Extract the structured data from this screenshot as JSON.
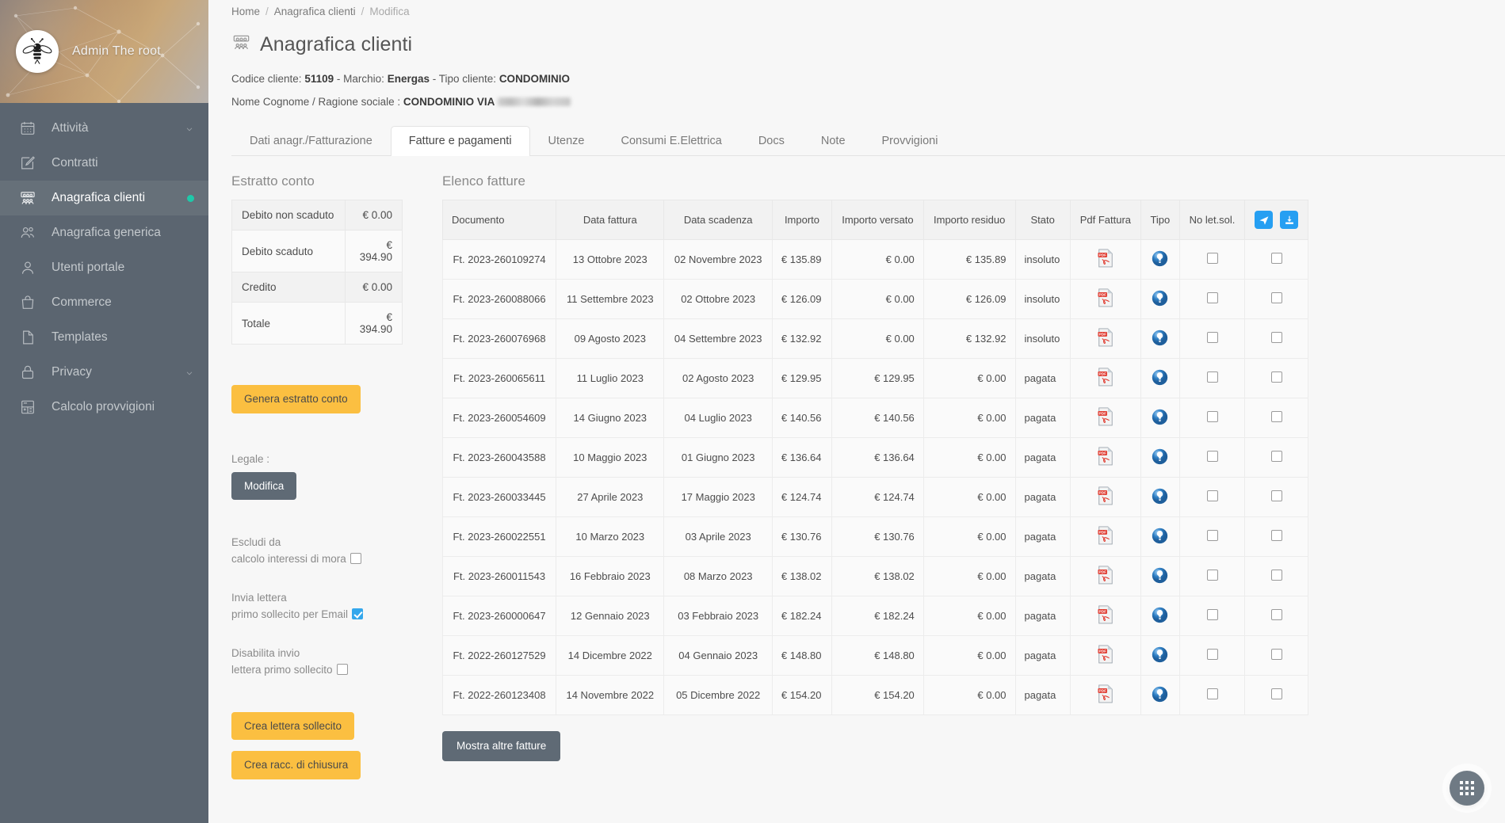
{
  "sidebar": {
    "profile": {
      "username": "Admin The root",
      "avatar_icon": "bee-logo"
    },
    "items": [
      {
        "label": "Attività",
        "icon": "calendar-icon",
        "expandable": true,
        "active": false,
        "dot": false
      },
      {
        "label": "Contratti",
        "icon": "edit-square-icon",
        "expandable": false,
        "active": false,
        "dot": false
      },
      {
        "label": "Anagrafica clienti",
        "icon": "clients-icon",
        "expandable": false,
        "active": true,
        "dot": true
      },
      {
        "label": "Anagrafica generica",
        "icon": "people-icon",
        "expandable": false,
        "active": false,
        "dot": false
      },
      {
        "label": "Utenti portale",
        "icon": "user-icon",
        "expandable": false,
        "active": false,
        "dot": false
      },
      {
        "label": "Commerce",
        "icon": "bag-icon",
        "expandable": false,
        "active": false,
        "dot": false
      },
      {
        "label": "Templates",
        "icon": "file-icon",
        "expandable": false,
        "active": false,
        "dot": false
      },
      {
        "label": "Privacy",
        "icon": "lock-icon",
        "expandable": true,
        "active": false,
        "dot": false
      },
      {
        "label": "Calcolo provvigioni",
        "icon": "calculator-icon",
        "expandable": false,
        "active": false,
        "dot": false
      }
    ]
  },
  "breadcrumb": {
    "home": "Home",
    "section": "Anagrafica clienti",
    "current": "Modifica",
    "separator": "/"
  },
  "page": {
    "title": "Anagrafica clienti",
    "icon": "clients-icon"
  },
  "customer": {
    "codice_label": "Codice cliente:",
    "codice_value": "51109",
    "dash1": "-",
    "marchio_label": "Marchio:",
    "marchio_value": "Energas",
    "dash2": "-",
    "tipo_label": "Tipo cliente:",
    "tipo_value": "CONDOMINIO",
    "nome_label": "Nome Cognome / Ragione sociale :",
    "nome_value": "CONDOMINIO VIA"
  },
  "tabs": [
    {
      "label": "Dati anagr./Fatturazione",
      "active": false
    },
    {
      "label": "Fatture e pagamenti",
      "active": true
    },
    {
      "label": "Utenze",
      "active": false
    },
    {
      "label": "Consumi E.Elettrica",
      "active": false
    },
    {
      "label": "Docs",
      "active": false
    },
    {
      "label": "Note",
      "active": false
    },
    {
      "label": "Provvigioni",
      "active": false
    }
  ],
  "estratto_conto": {
    "title": "Estratto conto",
    "rows": [
      {
        "label": "Debito non scaduto",
        "value": "€ 0.00"
      },
      {
        "label": "Debito scaduto",
        "value": "€ 394.90"
      },
      {
        "label": "Credito",
        "value": "€ 0.00"
      },
      {
        "label": "Totale",
        "value": "€ 394.90"
      }
    ],
    "genera_button": "Genera estratto conto",
    "legale_label": "Legale :",
    "modifica_button": "Modifica",
    "checkboxes": [
      {
        "line1": "Escludi da",
        "line2": "calcolo interessi di mora",
        "checked": false
      },
      {
        "line1": "Invia lettera",
        "line2": "primo sollecito per Email",
        "checked": true
      },
      {
        "line1": "Disabilita invio",
        "line2": "lettera primo sollecito",
        "checked": false
      }
    ],
    "crea_lettera_button": "Crea lettera sollecito",
    "crea_racc_button": "Crea racc. di chiusura"
  },
  "invoices": {
    "title": "Elenco fatture",
    "columns": [
      "Documento",
      "Data fattura",
      "Data scadenza",
      "Importo",
      "Importo versato",
      "Importo residuo",
      "Stato",
      "Pdf Fattura",
      "Tipo",
      "No let.sol."
    ],
    "header_actions": [
      {
        "name": "send-icon",
        "title": "Invia"
      },
      {
        "name": "download-icon",
        "title": "Scarica"
      }
    ],
    "rows": [
      {
        "documento": "Ft. 2023-260109274",
        "data_fattura": "13 Ottobre 2023",
        "data_scadenza": "02 Novembre 2023",
        "importo": "€ 135.89",
        "importo_versato": "€ 0.00",
        "importo_residuo": "€ 135.89",
        "stato": "insoluto",
        "pdf": "pdf-icon",
        "tipo": "bulb-icon",
        "no_let_sol": false,
        "azione": false
      },
      {
        "documento": "Ft. 2023-260088066",
        "data_fattura": "11 Settembre 2023",
        "data_scadenza": "02 Ottobre 2023",
        "importo": "€ 126.09",
        "importo_versato": "€ 0.00",
        "importo_residuo": "€ 126.09",
        "stato": "insoluto",
        "pdf": "pdf-icon",
        "tipo": "bulb-icon",
        "no_let_sol": false,
        "azione": false
      },
      {
        "documento": "Ft. 2023-260076968",
        "data_fattura": "09 Agosto 2023",
        "data_scadenza": "04 Settembre 2023",
        "importo": "€ 132.92",
        "importo_versato": "€ 0.00",
        "importo_residuo": "€ 132.92",
        "stato": "insoluto",
        "pdf": "pdf-icon",
        "tipo": "bulb-icon",
        "no_let_sol": false,
        "azione": false
      },
      {
        "documento": "Ft. 2023-260065611",
        "data_fattura": "11 Luglio 2023",
        "data_scadenza": "02 Agosto 2023",
        "importo": "€ 129.95",
        "importo_versato": "€ 129.95",
        "importo_residuo": "€ 0.00",
        "stato": "pagata",
        "pdf": "pdf-icon",
        "tipo": "bulb-icon",
        "no_let_sol": false,
        "azione": false
      },
      {
        "documento": "Ft. 2023-260054609",
        "data_fattura": "14 Giugno 2023",
        "data_scadenza": "04 Luglio 2023",
        "importo": "€ 140.56",
        "importo_versato": "€ 140.56",
        "importo_residuo": "€ 0.00",
        "stato": "pagata",
        "pdf": "pdf-icon",
        "tipo": "bulb-icon",
        "no_let_sol": false,
        "azione": false
      },
      {
        "documento": "Ft. 2023-260043588",
        "data_fattura": "10 Maggio 2023",
        "data_scadenza": "01 Giugno 2023",
        "importo": "€ 136.64",
        "importo_versato": "€ 136.64",
        "importo_residuo": "€ 0.00",
        "stato": "pagata",
        "pdf": "pdf-icon",
        "tipo": "bulb-icon",
        "no_let_sol": false,
        "azione": false
      },
      {
        "documento": "Ft. 2023-260033445",
        "data_fattura": "27 Aprile 2023",
        "data_scadenza": "17 Maggio 2023",
        "importo": "€ 124.74",
        "importo_versato": "€ 124.74",
        "importo_residuo": "€ 0.00",
        "stato": "pagata",
        "pdf": "pdf-icon",
        "tipo": "bulb-icon",
        "no_let_sol": false,
        "azione": false
      },
      {
        "documento": "Ft. 2023-260022551",
        "data_fattura": "10 Marzo 2023",
        "data_scadenza": "03 Aprile 2023",
        "importo": "€ 130.76",
        "importo_versato": "€ 130.76",
        "importo_residuo": "€ 0.00",
        "stato": "pagata",
        "pdf": "pdf-icon",
        "tipo": "bulb-icon",
        "no_let_sol": false,
        "azione": false
      },
      {
        "documento": "Ft. 2023-260011543",
        "data_fattura": "16 Febbraio 2023",
        "data_scadenza": "08 Marzo 2023",
        "importo": "€ 138.02",
        "importo_versato": "€ 138.02",
        "importo_residuo": "€ 0.00",
        "stato": "pagata",
        "pdf": "pdf-icon",
        "tipo": "bulb-icon",
        "no_let_sol": false,
        "azione": false
      },
      {
        "documento": "Ft. 2023-260000647",
        "data_fattura": "12 Gennaio 2023",
        "data_scadenza": "03 Febbraio 2023",
        "importo": "€ 182.24",
        "importo_versato": "€ 182.24",
        "importo_residuo": "€ 0.00",
        "stato": "pagata",
        "pdf": "pdf-icon",
        "tipo": "bulb-icon",
        "no_let_sol": false,
        "azione": false
      },
      {
        "documento": "Ft. 2022-260127529",
        "data_fattura": "14 Dicembre 2022",
        "data_scadenza": "04 Gennaio 2023",
        "importo": "€ 148.80",
        "importo_versato": "€ 148.80",
        "importo_residuo": "€ 0.00",
        "stato": "pagata",
        "pdf": "pdf-icon",
        "tipo": "bulb-icon",
        "no_let_sol": false,
        "azione": false
      },
      {
        "documento": "Ft. 2022-260123408",
        "data_fattura": "14 Novembre 2022",
        "data_scadenza": "05 Dicembre 2022",
        "importo": "€ 154.20",
        "importo_versato": "€ 154.20",
        "importo_residuo": "€ 0.00",
        "stato": "pagata",
        "pdf": "pdf-icon",
        "tipo": "bulb-icon",
        "no_let_sol": false,
        "azione": false
      }
    ],
    "mostra_button": "Mostra altre fatture"
  },
  "fab": {
    "icon": "apps-grid-icon"
  },
  "colors": {
    "sidebar_bg": "#5b6570",
    "sidebar_active_bg": "#667079",
    "accent_amber": "#fbbf41",
    "accent_blue": "#269ff2",
    "grey_button": "#5f6a75",
    "status_dot_green": "#1fc8a9",
    "page_bg": "#f7f7f7"
  }
}
